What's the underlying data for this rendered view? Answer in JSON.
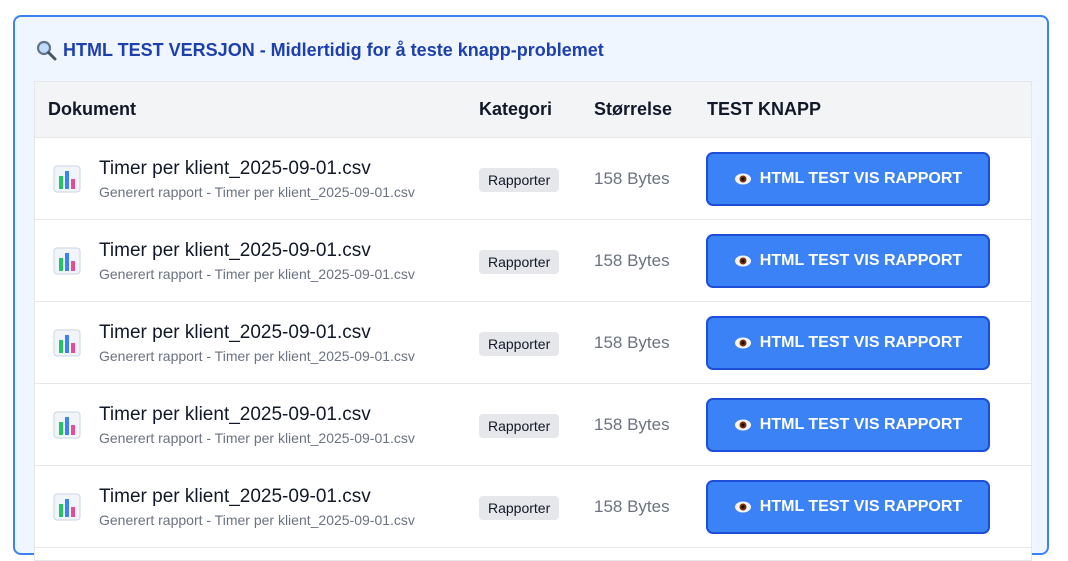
{
  "panel": {
    "title": "HTML TEST VERSJON - Midlertidig for å teste knapp-problemet",
    "icon": "magnifier-icon"
  },
  "table": {
    "headers": {
      "document": "Dokument",
      "category": "Kategori",
      "size": "Størrelse",
      "action": "TEST KNAPP"
    },
    "rows": [
      {
        "name": "Timer per klient_2025-09-01.csv",
        "subtitle": "Generert rapport - Timer per klient_2025-09-01.csv",
        "category": "Rapporter",
        "size": "158 Bytes",
        "button": "HTML TEST VIS RAPPORT"
      },
      {
        "name": "Timer per klient_2025-09-01.csv",
        "subtitle": "Generert rapport - Timer per klient_2025-09-01.csv",
        "category": "Rapporter",
        "size": "158 Bytes",
        "button": "HTML TEST VIS RAPPORT"
      },
      {
        "name": "Timer per klient_2025-09-01.csv",
        "subtitle": "Generert rapport - Timer per klient_2025-09-01.csv",
        "category": "Rapporter",
        "size": "158 Bytes",
        "button": "HTML TEST VIS RAPPORT"
      },
      {
        "name": "Timer per klient_2025-09-01.csv",
        "subtitle": "Generert rapport - Timer per klient_2025-09-01.csv",
        "category": "Rapporter",
        "size": "158 Bytes",
        "button": "HTML TEST VIS RAPPORT"
      },
      {
        "name": "Timer per klient_2025-09-01.csv",
        "subtitle": "Generert rapport - Timer per klient_2025-09-01.csv",
        "category": "Rapporter",
        "size": "158 Bytes",
        "button": "HTML TEST VIS RAPPORT"
      }
    ]
  },
  "colors": {
    "accent": "#3b82f6",
    "panel_bg": "#eff6ff",
    "title": "#1e40af"
  }
}
